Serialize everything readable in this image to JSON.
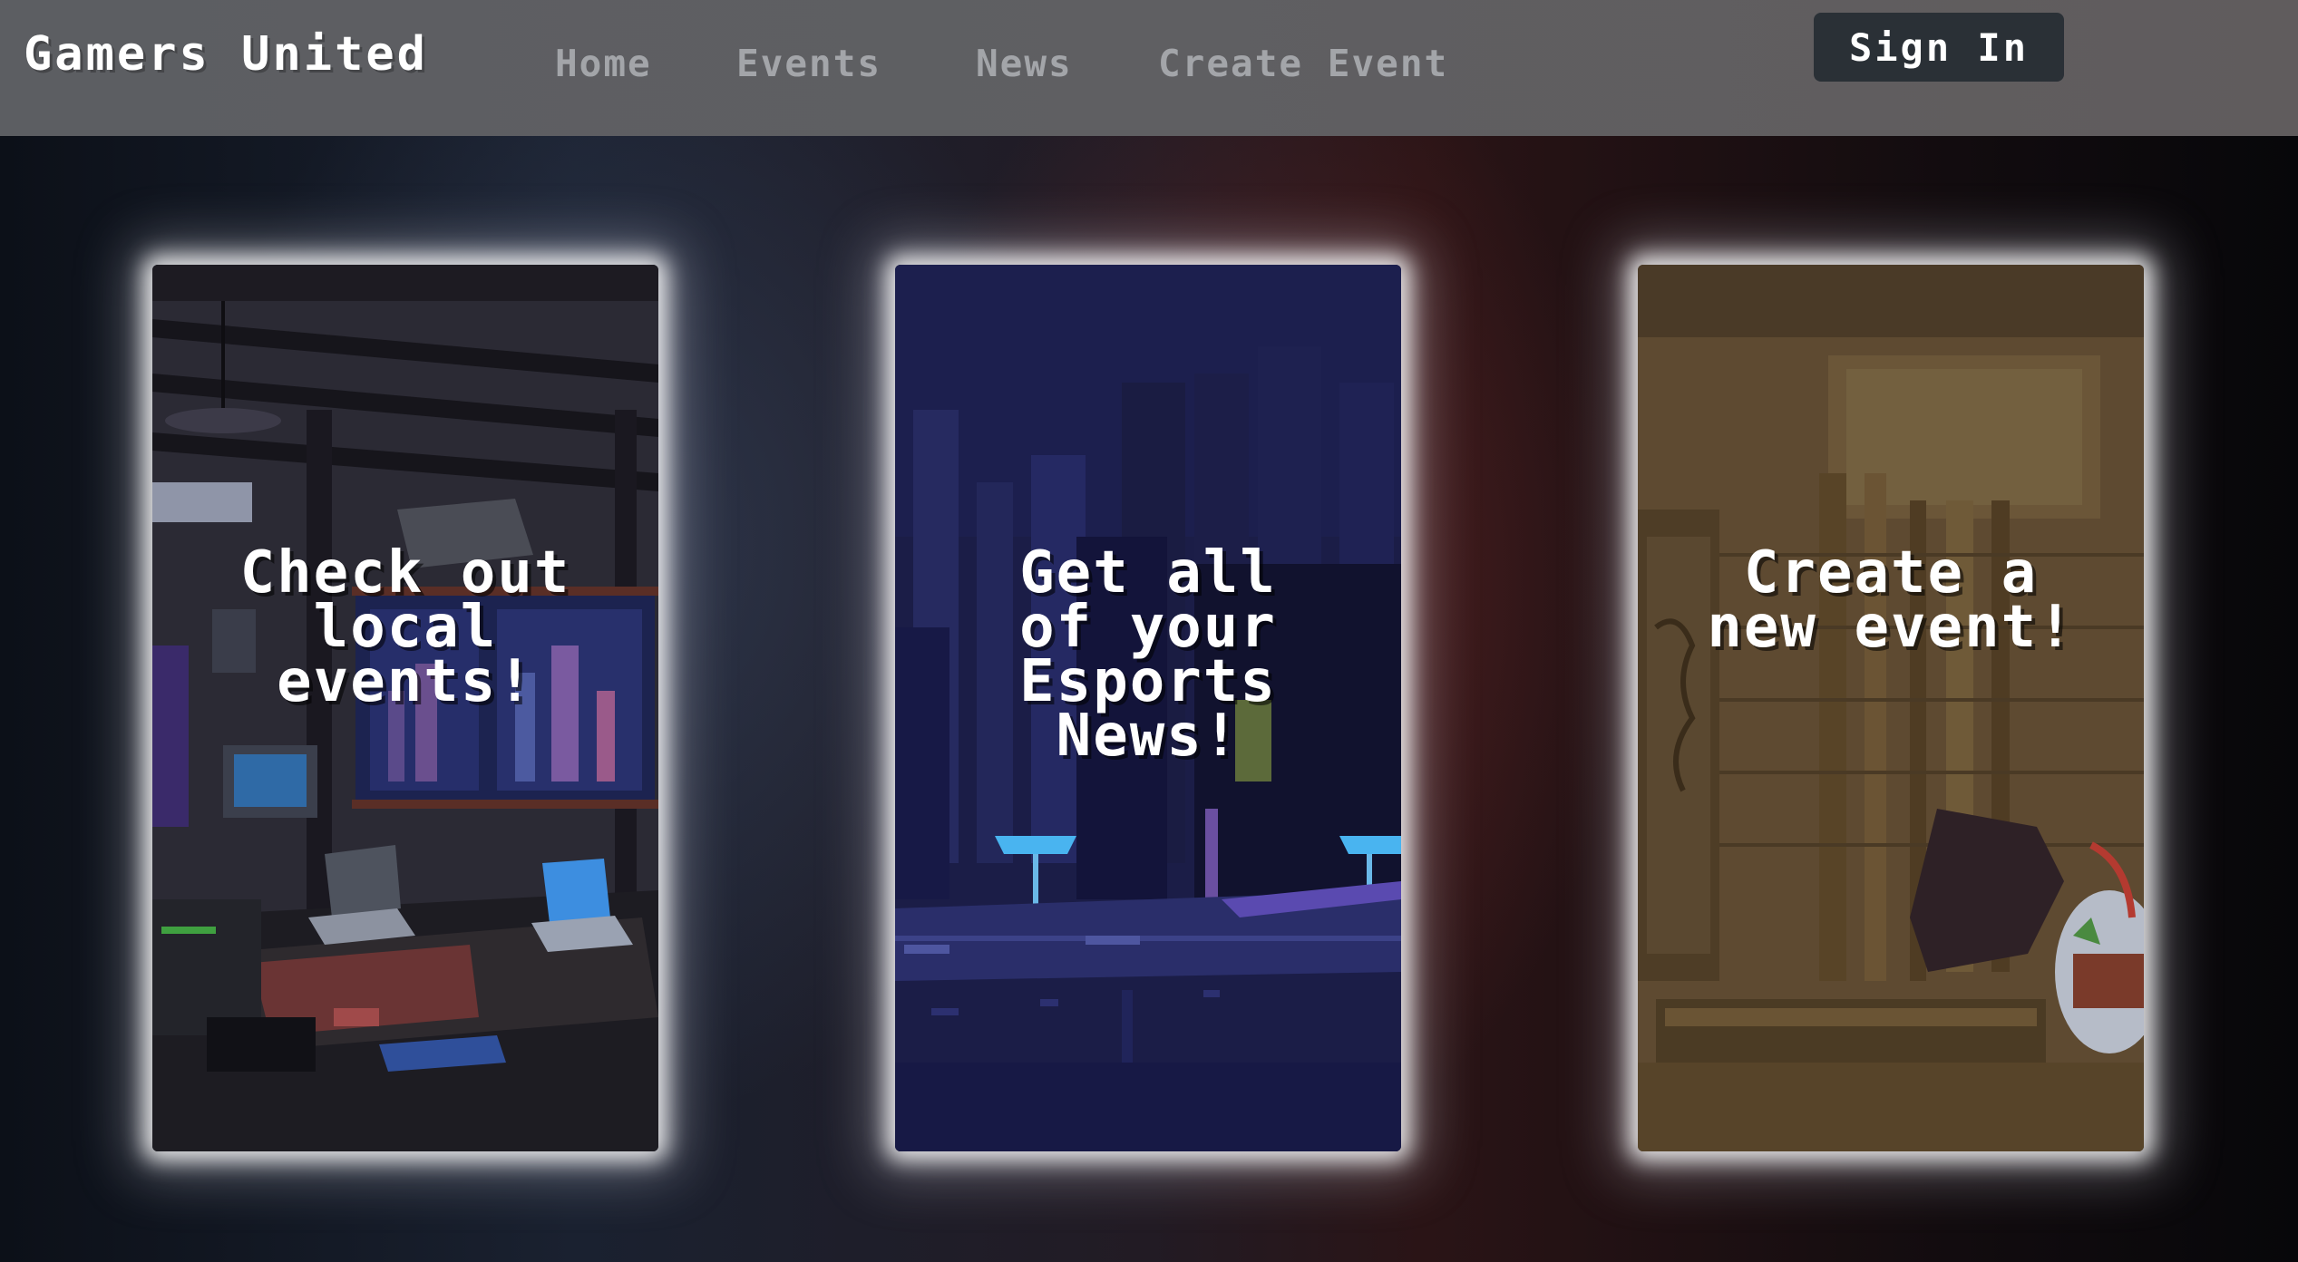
{
  "navbar": {
    "brand": "Gamers United",
    "links": [
      {
        "label": "Home"
      },
      {
        "label": "Events"
      },
      {
        "label": "News"
      },
      {
        "label": "Create Event"
      }
    ],
    "sign_in_label": "Sign In"
  },
  "cards": [
    {
      "text": "Check out local events!",
      "art": "pixel-art-gamer-room"
    },
    {
      "text": "Get all of your Esports News!",
      "art": "pixel-art-night-city"
    },
    {
      "text": "Create a new event!",
      "art": "pixel-art-temple-ruins"
    }
  ],
  "colors": {
    "navbar_bg": "#5f5f62",
    "nav_link": "#a3a5a9",
    "brand_text": "#ffffff",
    "sign_in_bg": "#2a3036",
    "card_glow": "#ffffff"
  }
}
